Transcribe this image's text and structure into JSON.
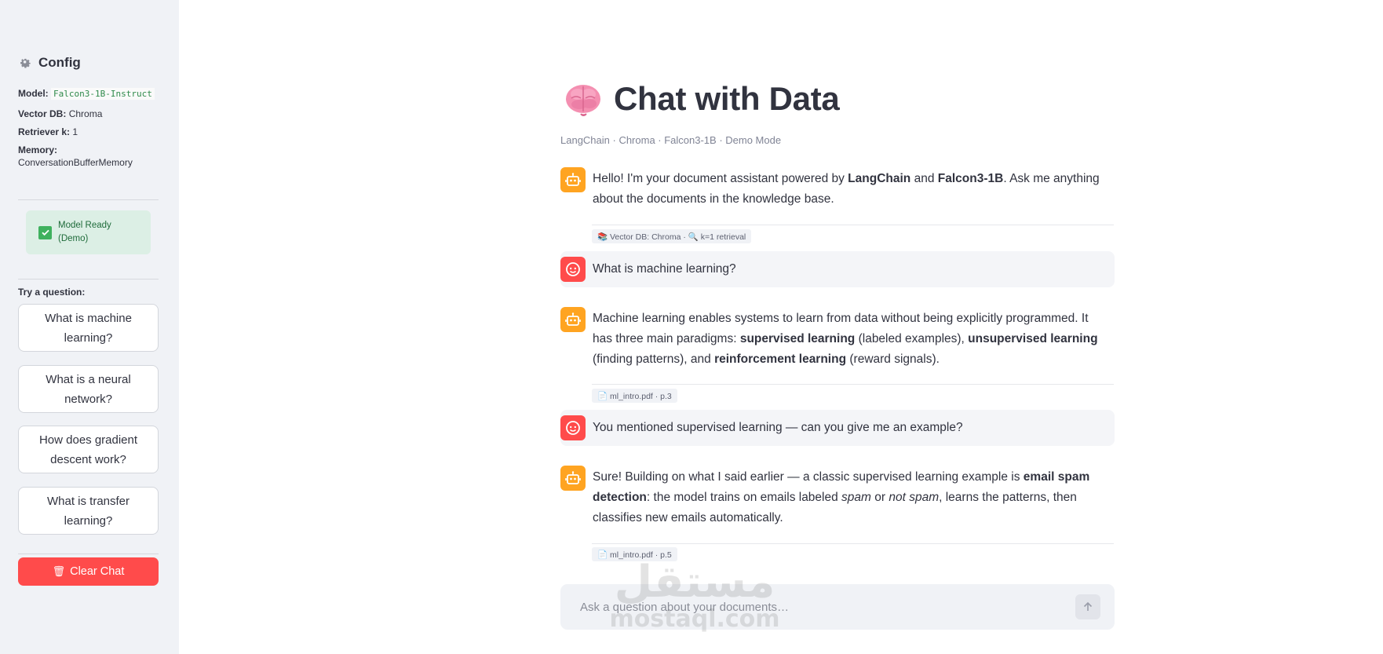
{
  "sidebar": {
    "title": "Config",
    "config": {
      "model_label": "Model:",
      "model_value": "Falcon3-1B-Instruct",
      "vectordb_label": "Vector DB:",
      "vectordb_value": "Chroma",
      "retriever_label": "Retriever k:",
      "retriever_value": "1",
      "memory_label": "Memory:",
      "memory_value": "ConversationBufferMemory"
    },
    "status": "Model Ready (Demo)",
    "try_label": "Try a question:",
    "questions": [
      "What is machine learning?",
      "What is a neural network?",
      "How does gradient descent work?",
      "What is transfer learning?"
    ],
    "clear_label": "Clear Chat"
  },
  "main": {
    "title": "Chat with Data",
    "subtitle": "LangChain · Chroma · Falcon3-1B · Demo Mode",
    "messages": [
      {
        "role": "assistant",
        "parts": [
          "Hello! I'm your document assistant powered by ",
          "LangChain",
          " and ",
          "Falcon3-1B",
          ". Ask me anything about the documents in the knowledge base."
        ],
        "source": "📚 Vector DB: Chroma · 🔍 k=1 retrieval"
      },
      {
        "role": "user",
        "text": "What is machine learning?"
      },
      {
        "role": "assistant",
        "parts": [
          "Machine learning enables systems to learn from data without being explicitly programmed. It has three main paradigms: ",
          "supervised learning",
          " (labeled examples), ",
          "unsupervised learning",
          " (finding patterns), and ",
          "reinforcement learning",
          " (reward signals)."
        ],
        "source": "📄 ml_intro.pdf · p.3"
      },
      {
        "role": "user",
        "text": "You mentioned supervised learning — can you give me an example?"
      },
      {
        "role": "assistant",
        "parts": [
          "Sure! Building on what I said earlier — a classic supervised learning example is ",
          "email spam detection",
          ": the model trains on emails labeled ",
          "spam",
          " or ",
          "not spam",
          ", learns the patterns, then classifies new emails automatically."
        ],
        "source": "📄 ml_intro.pdf · p.5"
      }
    ],
    "input_placeholder": "Ask a question about your documents…"
  },
  "watermark": {
    "arabic": "مستقل",
    "latin": "mostaql.com"
  },
  "colors": {
    "sidebar_bg": "#f0f2f6",
    "bot_avatar": "#ffa421",
    "user_avatar": "#ff4b4b",
    "clear_button": "#ff4b4b",
    "status_bg": "#dcefe5",
    "status_check": "#3fb15e"
  }
}
